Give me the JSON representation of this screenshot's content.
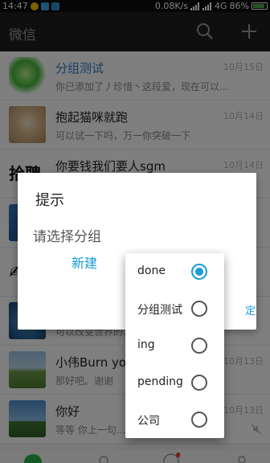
{
  "status_bar": {
    "time": "14:47",
    "speed": "0.08K/s",
    "network": "4G",
    "battery": "86%",
    "battery_level": 0.86
  },
  "app_bar": {
    "title": "微信",
    "search_icon": "search-icon",
    "add_icon": "plus-icon"
  },
  "chats": [
    {
      "name": "分组测试",
      "message": "你已添加了丿珍惜丶这段爱，现在可以...",
      "time": "10月15日",
      "name_color": "#2e7bc4"
    },
    {
      "name": "抱起猫咪就跑",
      "message": "可以试一下吗，万一你突破一下",
      "time": "10月14日",
      "name_color": "#222222"
    },
    {
      "name": "你要钱我们要人sgm",
      "message": "",
      "time": "10月14日",
      "name_color": "#222222"
    },
    {
      "name": "",
      "message": "",
      "time": "",
      "name_color": "#222222"
    },
    {
      "name": "",
      "message": "",
      "time": "",
      "name_color": "#222222"
    },
    {
      "name": "",
      "message": "可以改变世界的...",
      "time": "",
      "name_color": "#222222"
    },
    {
      "name": "小伟Burn you",
      "message": "那好吧。谢谢",
      "time": "10月13日",
      "name_color": "#222222"
    },
    {
      "name": "你好",
      "message": "等等   你上一句...",
      "time": "10月13日",
      "name_color": "#222222"
    }
  ],
  "dialog": {
    "title": "提示",
    "message": "请选择分组",
    "new_button": "新建",
    "confirm_button": "定"
  },
  "group_popup": {
    "options": [
      {
        "label": "done",
        "checked": true
      },
      {
        "label": "分组测试",
        "checked": false
      },
      {
        "label": "ing",
        "checked": false
      },
      {
        "label": "pending",
        "checked": false
      },
      {
        "label": "公司",
        "checked": false
      }
    ]
  },
  "colors": {
    "accent": "#1a9bd7",
    "app_bar": "#1f1f1f",
    "status_bar": "#0c0c0c"
  }
}
